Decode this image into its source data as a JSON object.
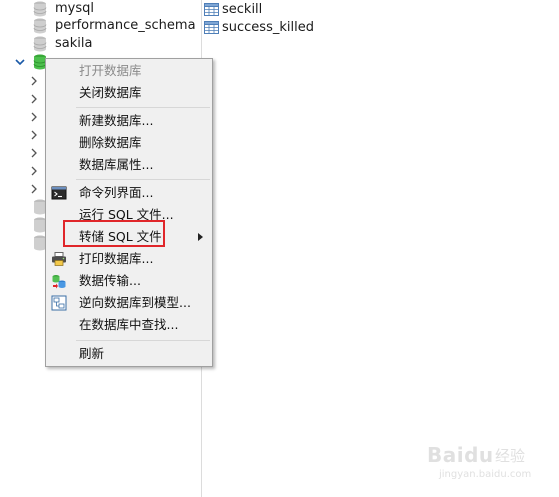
{
  "tree": {
    "items": [
      {
        "label": "mysql"
      },
      {
        "label": "performance_schema"
      },
      {
        "label": "sakila"
      }
    ]
  },
  "right_pane": {
    "tables": [
      {
        "label": "seckill"
      },
      {
        "label": "success_killed"
      }
    ]
  },
  "context_menu": {
    "open_db": "打开数据库",
    "close_db": "关闭数据库",
    "new_db": "新建数据库...",
    "delete_db": "删除数据库",
    "db_properties": "数据库属性...",
    "console": "命令列界面...",
    "run_sql": "运行 SQL 文件...",
    "dump_sql": "转储 SQL 文件",
    "print_db": "打印数据库...",
    "data_transfer": "数据传输...",
    "reverse_model": "逆向数据库到模型...",
    "find_in_db": "在数据库中查找...",
    "refresh": "刷新"
  },
  "watermark": {
    "brand": "Baidu",
    "sub": "经验",
    "url": "jingyan.baidu.com"
  },
  "colors": {
    "highlight": "#e0262a",
    "menu_bg": "#f0f0f0",
    "disabled_text": "#8a8a8a"
  }
}
